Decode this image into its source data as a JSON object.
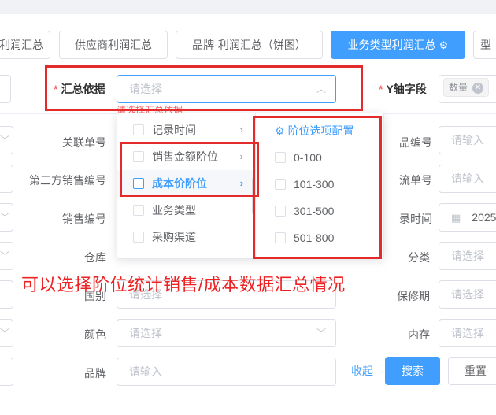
{
  "tabs": [
    {
      "label": "利润汇总"
    },
    {
      "label": "供应商利润汇总"
    },
    {
      "label": "品牌-利润汇总（饼图）"
    },
    {
      "label": "业务类型利润汇总"
    },
    {
      "label": "型"
    }
  ],
  "summary": {
    "label": "汇总依据",
    "placeholder": "请选择",
    "error": "请选择汇总依据"
  },
  "y_axis": {
    "label": "Y轴字段",
    "tag": "数量"
  },
  "form": {
    "left_labels": [
      "关联单号",
      "第三方销售编号",
      "销售编号",
      "仓库",
      "国别",
      "颜色",
      "品牌"
    ],
    "right_labels": [
      "品编号",
      "流单号",
      "录时间",
      "分类",
      "保修期",
      "内存"
    ],
    "placeholder_input": "请输入",
    "placeholder_select": "请选择",
    "date_value": "2025"
  },
  "dropdown": {
    "options": [
      {
        "label": "记录时间"
      },
      {
        "label": "销售金额阶位"
      },
      {
        "label": "成本价阶位"
      },
      {
        "label": "业务类型"
      },
      {
        "label": "采购渠道"
      }
    ],
    "submenu_title": "阶位选项配置",
    "submenu_items": [
      "0-100",
      "101-300",
      "301-500",
      "501-800"
    ]
  },
  "annotation": "可以选择阶位统计销售/成本数据汇总情况",
  "actions": {
    "collapse": "收起",
    "search": "搜索",
    "reset": "重置"
  },
  "colors": {
    "primary": "#409eff",
    "annotation_red": "#e42b2b",
    "error": "#f56c6c"
  }
}
